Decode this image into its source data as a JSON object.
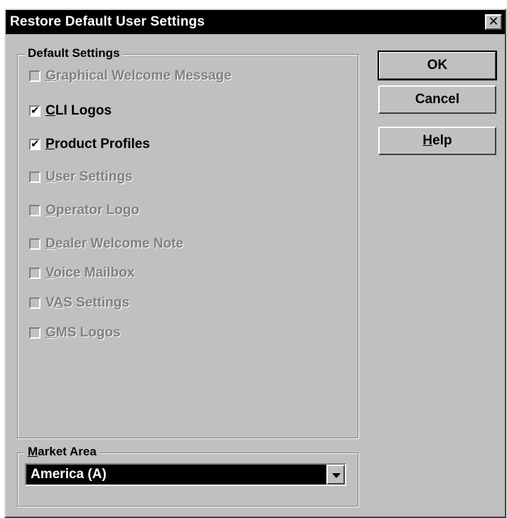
{
  "window": {
    "title": "Restore Default User Settings",
    "close_glyph": "✕"
  },
  "default_settings": {
    "label": "Default Settings",
    "items": [
      {
        "pre": "",
        "key": "G",
        "post": "raphical Welcome Message",
        "checked": false,
        "enabled": false
      },
      {
        "pre": "",
        "key": "C",
        "post": "LI Logos",
        "checked": true,
        "enabled": true
      },
      {
        "pre": "",
        "key": "P",
        "post": "roduct Profiles",
        "checked": true,
        "enabled": true
      },
      {
        "pre": "",
        "key": "U",
        "post": "ser Settings",
        "checked": false,
        "enabled": false
      },
      {
        "pre": "",
        "key": "O",
        "post": "perator Logo",
        "checked": false,
        "enabled": false
      },
      {
        "pre": "",
        "key": "D",
        "post": "ealer Welcome Note",
        "checked": false,
        "enabled": false
      },
      {
        "pre": "",
        "key": "V",
        "post": "oice Mailbox",
        "checked": false,
        "enabled": false
      },
      {
        "pre": "V",
        "key": "A",
        "post": "S Settings",
        "checked": false,
        "enabled": false
      },
      {
        "pre": "",
        "key": "G",
        "post": "MS Logos",
        "checked": false,
        "enabled": false
      }
    ]
  },
  "buttons": {
    "ok": "OK",
    "cancel": "Cancel",
    "help_key": "H",
    "help_rest": "elp"
  },
  "market_area": {
    "label_key": "M",
    "label_rest": "arket Area",
    "selected": "America (A)"
  },
  "colors": {
    "face": "#c0c0c0",
    "titlebar": "#000000",
    "disabled_text": "#808080"
  }
}
